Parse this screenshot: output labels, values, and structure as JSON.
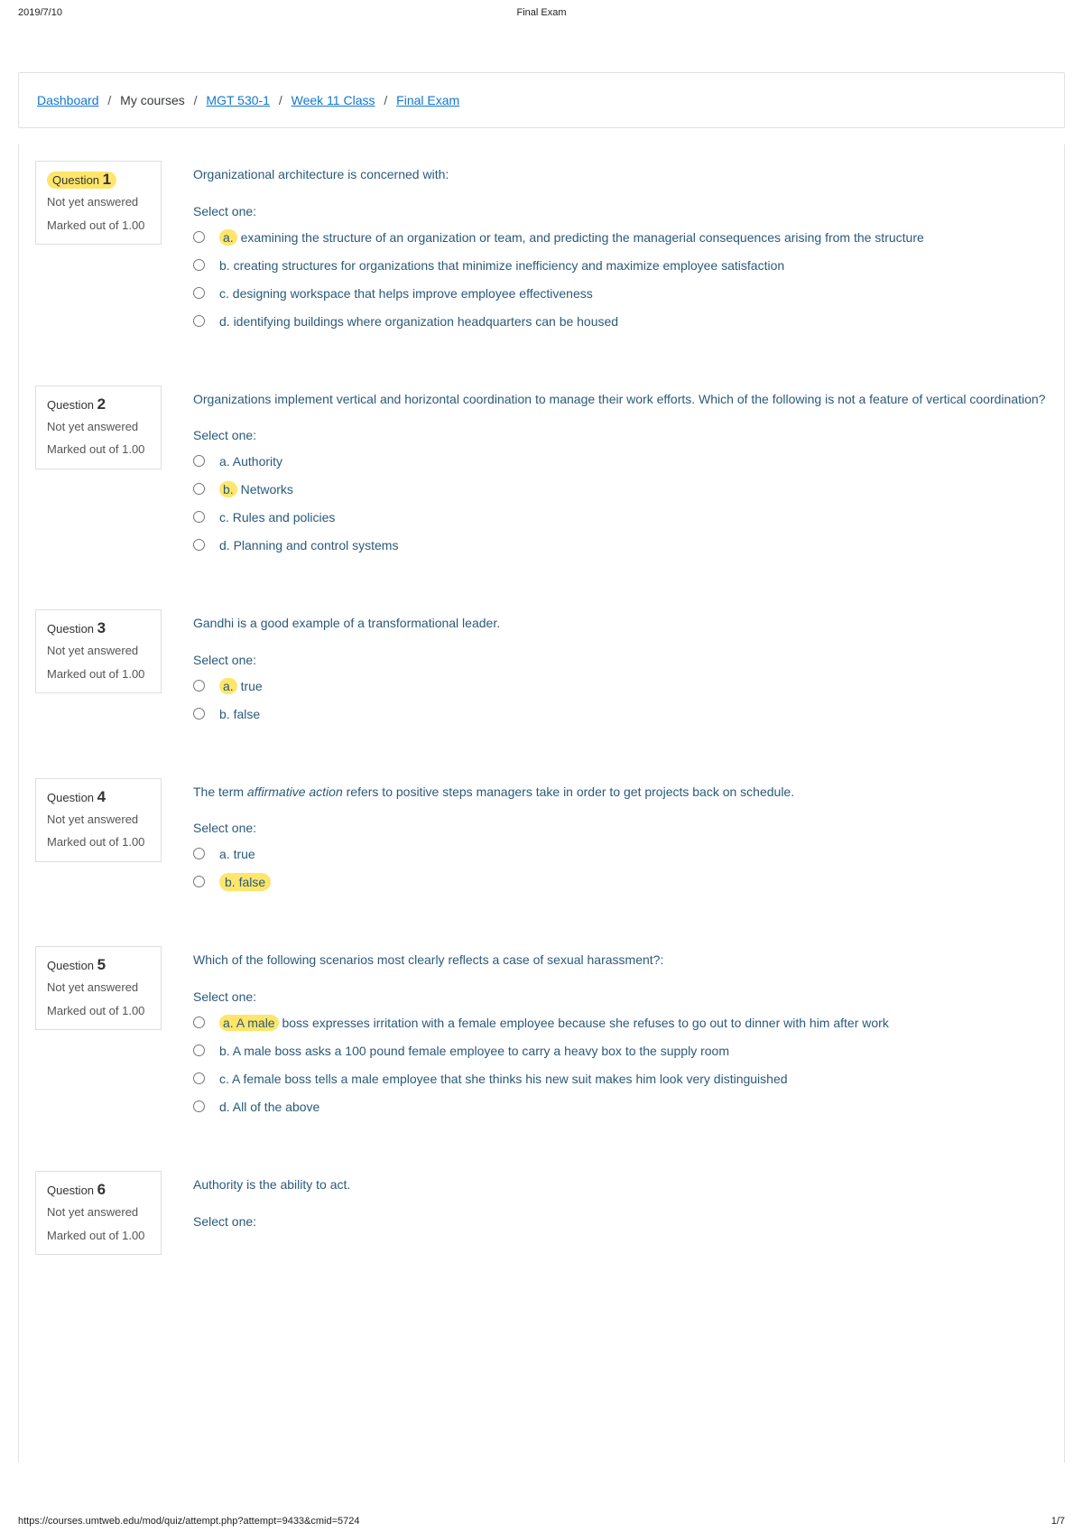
{
  "header": {
    "date": "2019/7/10",
    "title": "Final Exam"
  },
  "breadcrumb": {
    "dashboard": "Dashboard",
    "mycourses": "My courses",
    "course": "MGT 530-1",
    "week": "Week 11 Class",
    "exam": "Final Exam",
    "sep": "/"
  },
  "labels": {
    "question": "Question",
    "state": "Not yet answered",
    "grade": "Marked out of 1.00",
    "select": "Select one:"
  },
  "questions": [
    {
      "num": "1",
      "text": "Organizational architecture is concerned with:",
      "options": [
        {
          "label": "a.",
          "body": "examining the structure of an organization or team, and predicting the managerial consequences arising from the structure",
          "hl": "a."
        },
        {
          "label": "b.",
          "body": "creating structures for organizations that minimize inefficiency and maximize employee satisfaction"
        },
        {
          "label": "c.",
          "body": "designing workspace that helps improve employee effectiveness"
        },
        {
          "label": "d.",
          "body": "identifying buildings where organization headquarters can be housed"
        }
      ],
      "numHl": true
    },
    {
      "num": "2",
      "text": "Organizations implement vertical and horizontal coordination to manage their work efforts. Which of the following is not a feature of vertical coordination?",
      "options": [
        {
          "label": "a.",
          "body": "Authority"
        },
        {
          "label": "b.",
          "body": "Networks",
          "hl": "b."
        },
        {
          "label": "c.",
          "body": "Rules and policies"
        },
        {
          "label": "d.",
          "body": "Planning and control systems"
        }
      ]
    },
    {
      "num": "3",
      "text": "Gandhi is a good example of a transformational leader.",
      "options": [
        {
          "label": "a.",
          "body": "true",
          "hl": "a."
        },
        {
          "label": "b.",
          "body": "false"
        }
      ]
    },
    {
      "num": "4",
      "text_pre": "The term ",
      "text_em": "affirmative action",
      "text_post": " refers to positive steps managers take in order to get projects back on schedule.",
      "options": [
        {
          "label": "a.",
          "body": "true"
        },
        {
          "label": "b.",
          "body": "false",
          "hlFull": true
        }
      ]
    },
    {
      "num": "5",
      "text": "Which of the following scenarios most clearly reflects a case of sexual harassment?:",
      "options": [
        {
          "label": "a.",
          "body": "A male boss expresses irritation with a female employee because she refuses to go out to dinner with him after work",
          "hl": "a. A male"
        },
        {
          "label": "b.",
          "body": "A male boss asks a 100 pound female employee to carry a heavy box to the supply room"
        },
        {
          "label": "c.",
          "body": "A female boss tells a male employee that she thinks his new suit makes him look very distinguished"
        },
        {
          "label": "d.",
          "body": "All of the above"
        }
      ]
    },
    {
      "num": "6",
      "text": "Authority is the ability to act.",
      "options": [],
      "partial": true
    }
  ],
  "footer": {
    "url": "https://courses.umtweb.edu/mod/quiz/attempt.php?attempt=9433&cmid=5724",
    "page": "1/7"
  }
}
